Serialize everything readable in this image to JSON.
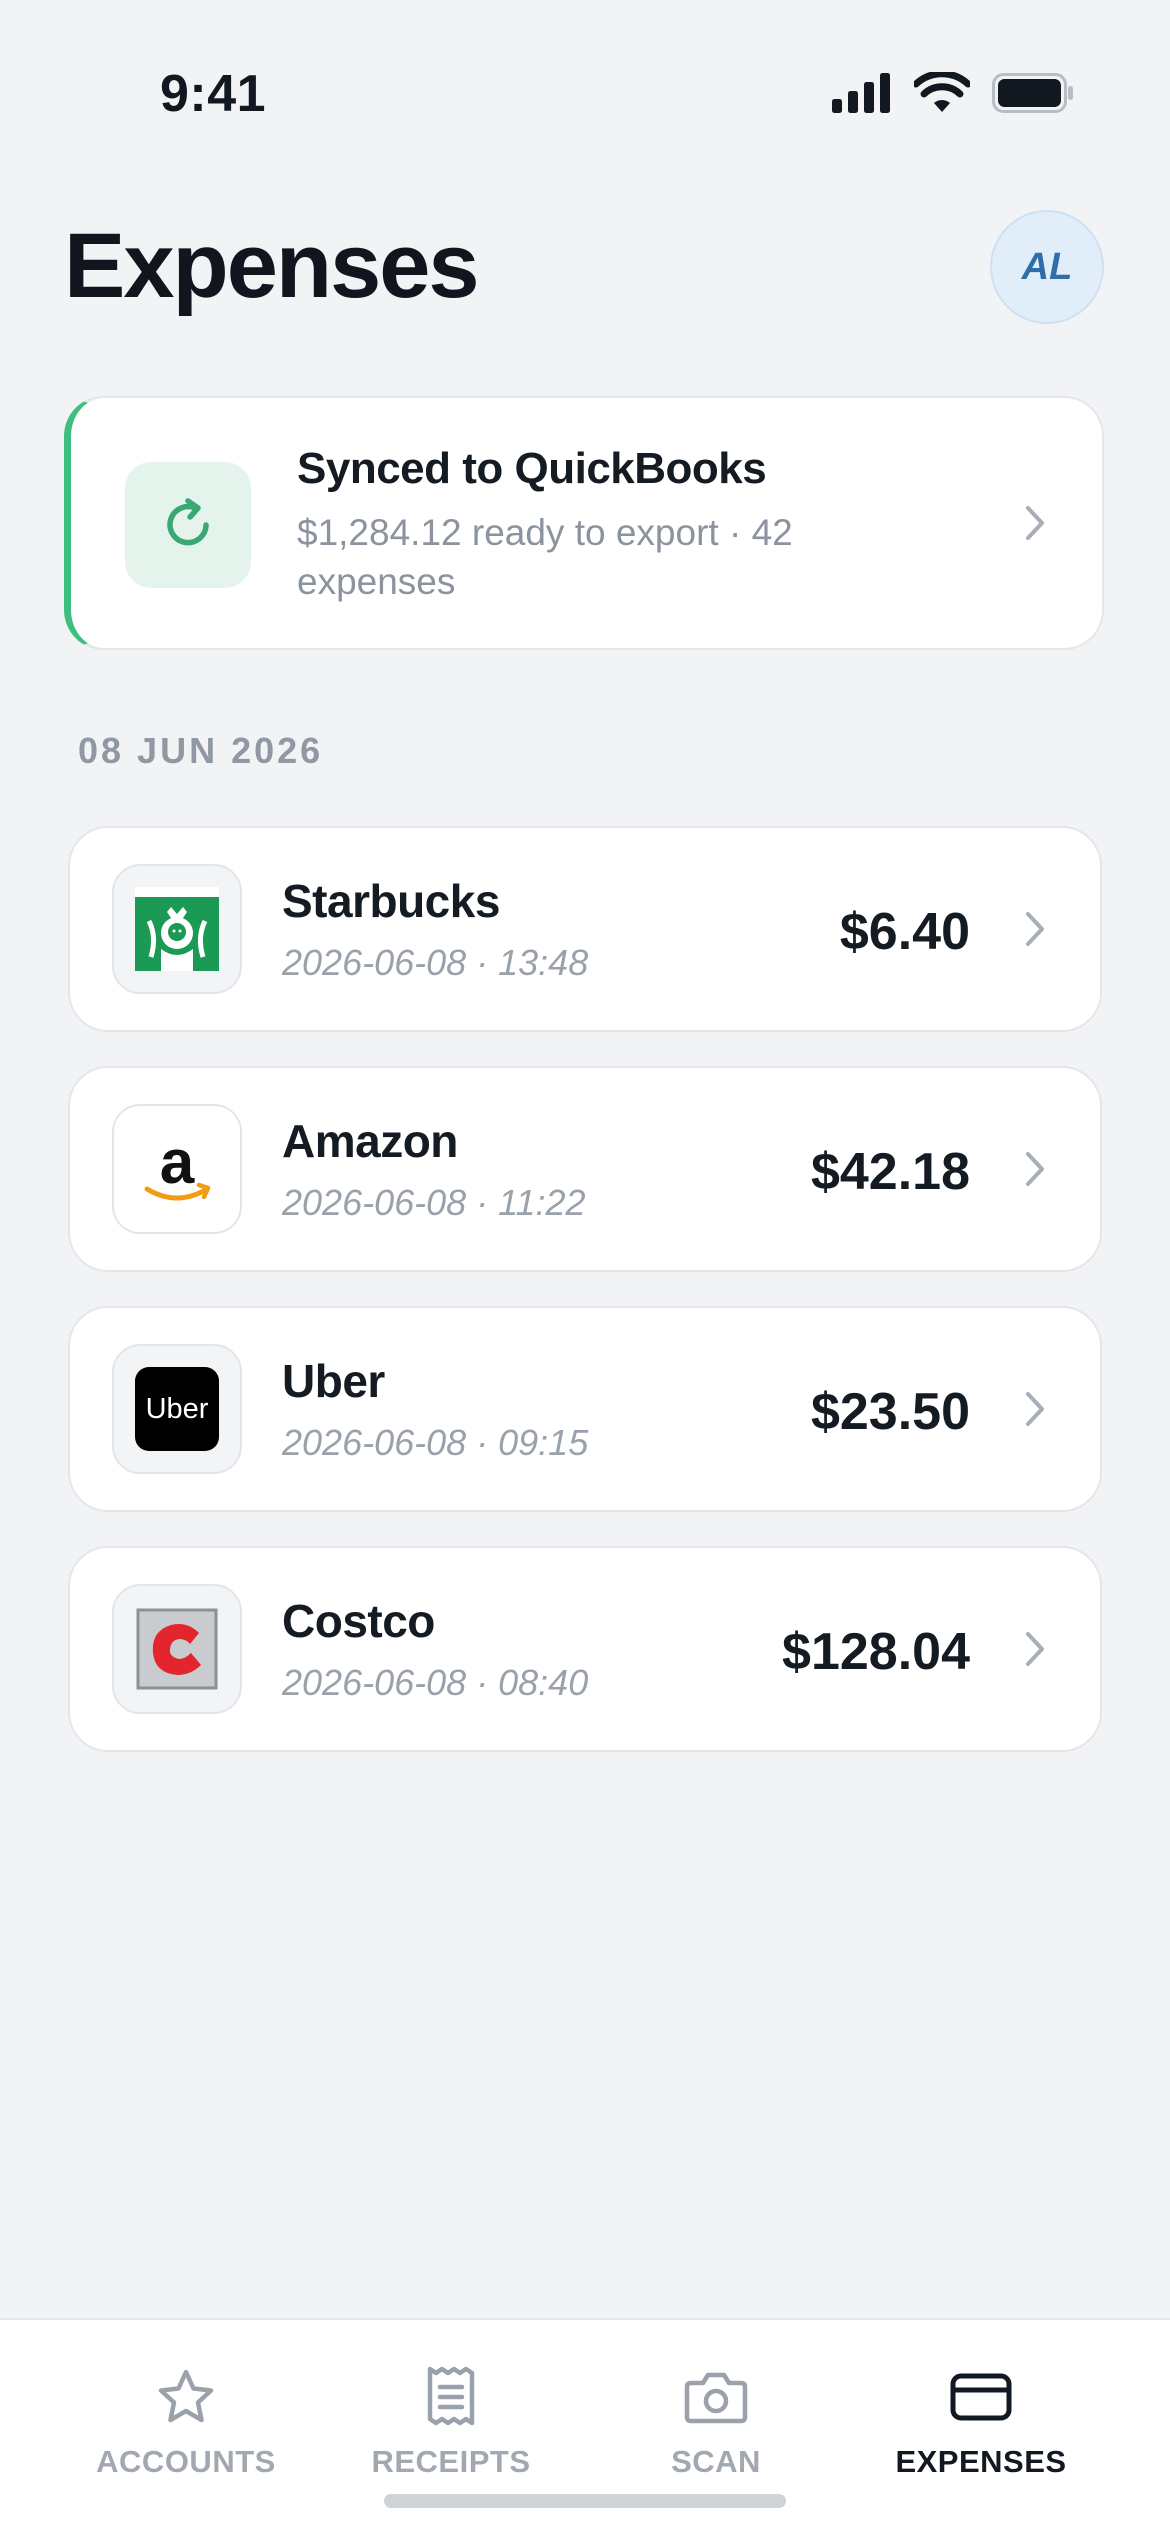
{
  "status_bar": {
    "time": "9:41"
  },
  "header": {
    "title": "Expenses",
    "avatar_initials": "AL"
  },
  "sync_card": {
    "icon": "sync-icon",
    "title": "Synced to QuickBooks",
    "subtitle": "$1,284.12 ready to export · 42 expenses"
  },
  "date_header": "08 JUN 2026",
  "expenses": [
    {
      "merchant": "Starbucks",
      "timestamp": "2026-06-08 · 13:48",
      "amount": "$6.40",
      "logo": "starbucks-logo"
    },
    {
      "merchant": "Amazon",
      "timestamp": "2026-06-08 · 11:22",
      "amount": "$42.18",
      "logo": "amazon-logo"
    },
    {
      "merchant": "Uber",
      "timestamp": "2026-06-08 · 09:15",
      "amount": "$23.50",
      "logo": "uber-logo",
      "logo_text": "Uber"
    },
    {
      "merchant": "Costco",
      "timestamp": "2026-06-08 · 08:40",
      "amount": "$128.04",
      "logo": "costco-logo"
    }
  ],
  "tab_bar": {
    "tabs": [
      {
        "label": "ACCOUNTS",
        "icon": "star-icon",
        "active": false
      },
      {
        "label": "RECEIPTS",
        "icon": "receipt-icon",
        "active": false
      },
      {
        "label": "SCAN",
        "icon": "camera-icon",
        "active": false
      },
      {
        "label": "EXPENSES",
        "icon": "card-icon",
        "active": true
      }
    ]
  },
  "colors": {
    "accent_green": "#3fbf7f",
    "avatar_blue": "#2f6ea8",
    "background": "#f2f3f5",
    "muted_text": "#99a1ab"
  }
}
